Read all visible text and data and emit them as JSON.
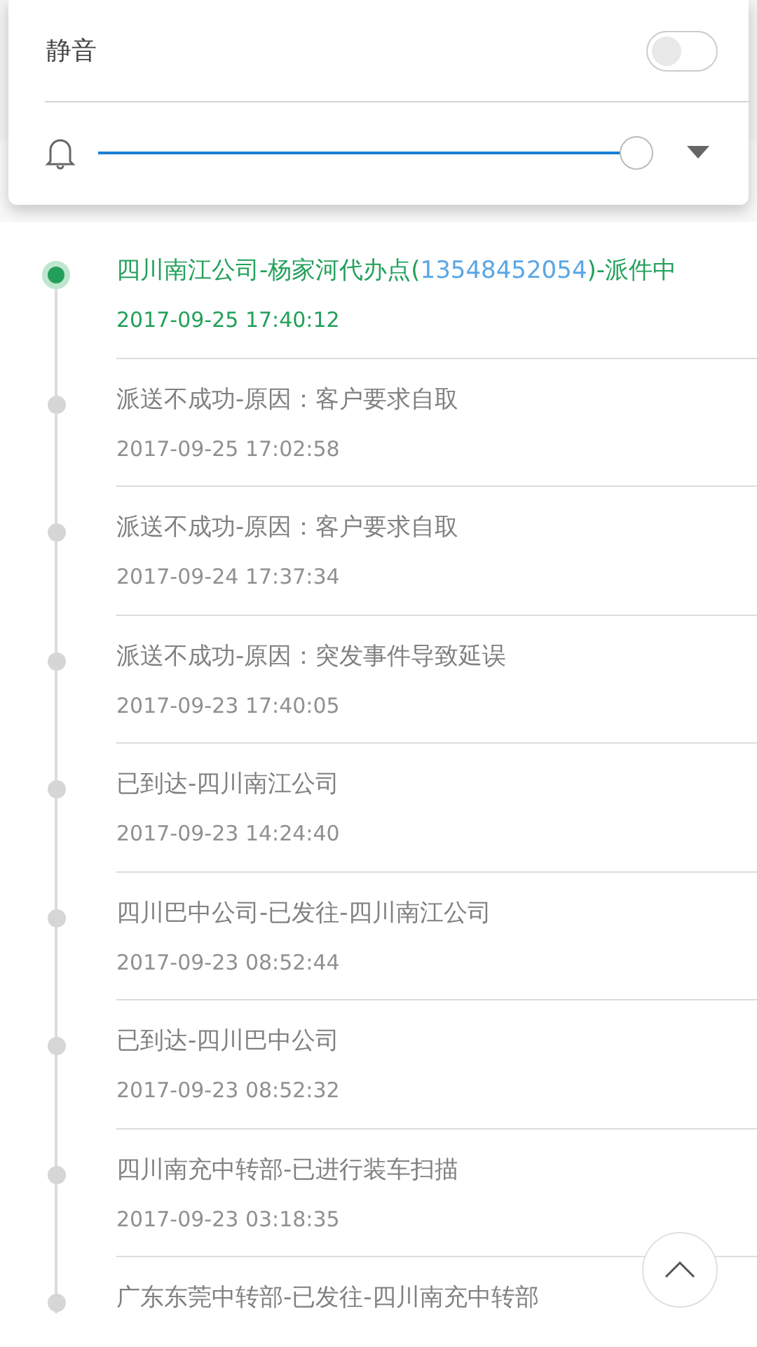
{
  "volume_panel": {
    "mute_label": "静音",
    "mute_on": false,
    "volume": {
      "level": 1.0
    }
  },
  "tracking": [
    {
      "text": "四川南江公司-杨家河代办点(",
      "phone": "13548452054",
      "text_after": ")-派件中",
      "time": "2017-09-25 17:40:12",
      "selected": true
    },
    {
      "text": "派送不成功-原因：客户要求自取",
      "time": "2017-09-25 17:02:58",
      "selected": false
    },
    {
      "text": "派送不成功-原因：客户要求自取",
      "time": "2017-09-24 17:37:34",
      "selected": false
    },
    {
      "text": "派送不成功-原因：突发事件导致延误",
      "time": "2017-09-23 17:40:05",
      "selected": false
    },
    {
      "text": "已到达-四川南江公司",
      "time": "2017-09-23 14:24:40",
      "selected": false
    },
    {
      "text": "四川巴中公司-已发往-四川南江公司",
      "time": "2017-09-23 08:52:44",
      "selected": false
    },
    {
      "text": "已到达-四川巴中公司",
      "time": "2017-09-23 08:52:32",
      "selected": false
    },
    {
      "text": "四川南充中转部-已进行装车扫描",
      "time": "2017-09-23 03:18:35",
      "selected": false
    },
    {
      "text": "广东东莞中转部-已发往-四川南充中转部",
      "selected": false
    }
  ]
}
